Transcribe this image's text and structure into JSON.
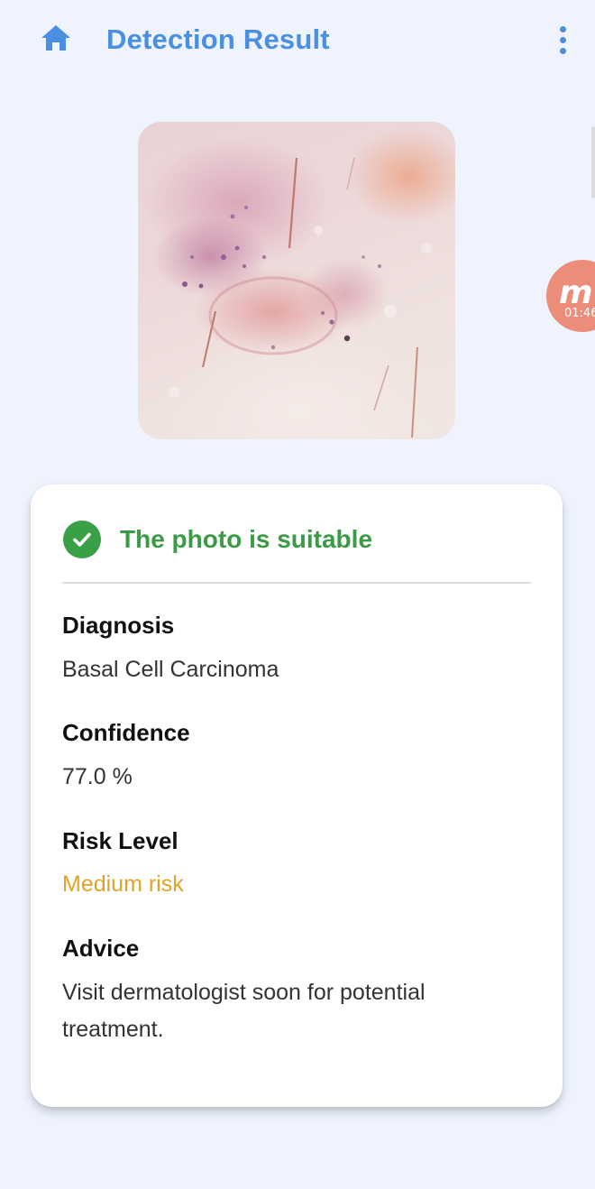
{
  "header": {
    "title": "Detection Result",
    "home_icon": "home-icon",
    "menu_icon": "more-vert-icon",
    "accent_color": "#4a8fe2"
  },
  "floating_recorder": {
    "timer": "01:46",
    "icon": "recorder-logo-icon",
    "color": "#ec8d7a"
  },
  "result": {
    "status_text": "The photo is suitable",
    "status_icon": "check-circle-icon",
    "status_color": "#3aa047",
    "fields": {
      "diagnosis": {
        "label": "Diagnosis",
        "value": "Basal Cell Carcinoma"
      },
      "confidence": {
        "label": "Confidence",
        "value": "77.0 %"
      },
      "risk_level": {
        "label": "Risk Level",
        "value": "Medium risk",
        "color": "#e0a229"
      },
      "advice": {
        "label": "Advice",
        "value": "Visit dermatologist soon for potential treatment."
      }
    }
  }
}
